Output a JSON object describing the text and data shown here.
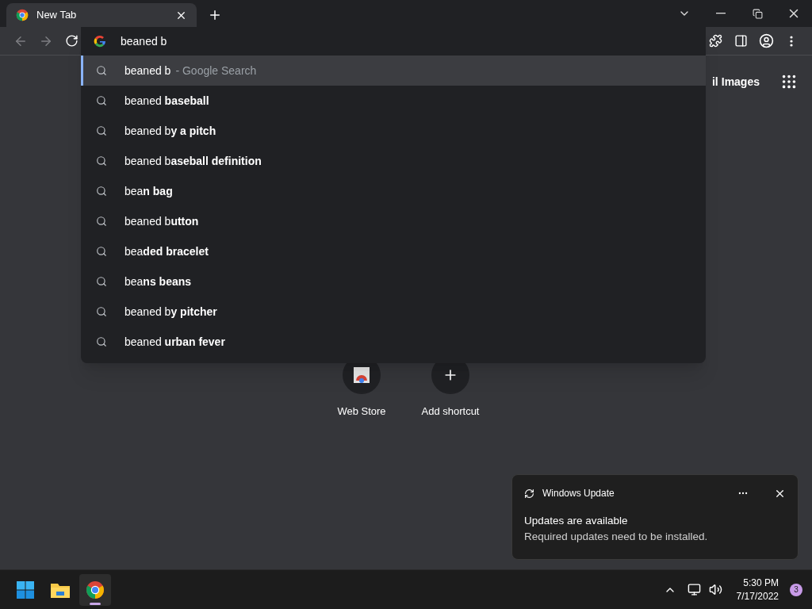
{
  "tab": {
    "title": "New Tab"
  },
  "omnibox": {
    "value": "beaned b"
  },
  "suggestions": [
    {
      "text": "beaned b",
      "suffix": "- Google Search",
      "selected": true
    },
    {
      "text": "beaned **baseball**",
      "selected": false
    },
    {
      "text": "beaned b**y a pitch**",
      "selected": false
    },
    {
      "text": "beaned b**aseball definition**",
      "selected": false
    },
    {
      "text": "bea**n bag**",
      "selected": false
    },
    {
      "text": "beaned b**utton**",
      "selected": false
    },
    {
      "text": "bea**ded bracelet**",
      "selected": false
    },
    {
      "text": "bea**ns beans**",
      "selected": false
    },
    {
      "text": "beaned b**y pitcher**",
      "selected": false
    },
    {
      "text": "beaned **urban fever**",
      "selected": false
    }
  ],
  "header_links": [
    "il",
    "Images"
  ],
  "shortcuts": [
    {
      "kind": "store",
      "label": "Web Store"
    },
    {
      "kind": "add",
      "label": "Add shortcut"
    }
  ],
  "notification": {
    "app": "Windows Update",
    "title": "Updates are available",
    "body": "Required updates need to be installed."
  },
  "taskbar": {
    "apps": [
      {
        "kind": "start",
        "selected": false
      },
      {
        "kind": "explorer",
        "selected": false
      },
      {
        "kind": "chrome",
        "selected": true
      }
    ],
    "time": "5:30 PM",
    "date": "7/17/2022",
    "badge": "3"
  }
}
